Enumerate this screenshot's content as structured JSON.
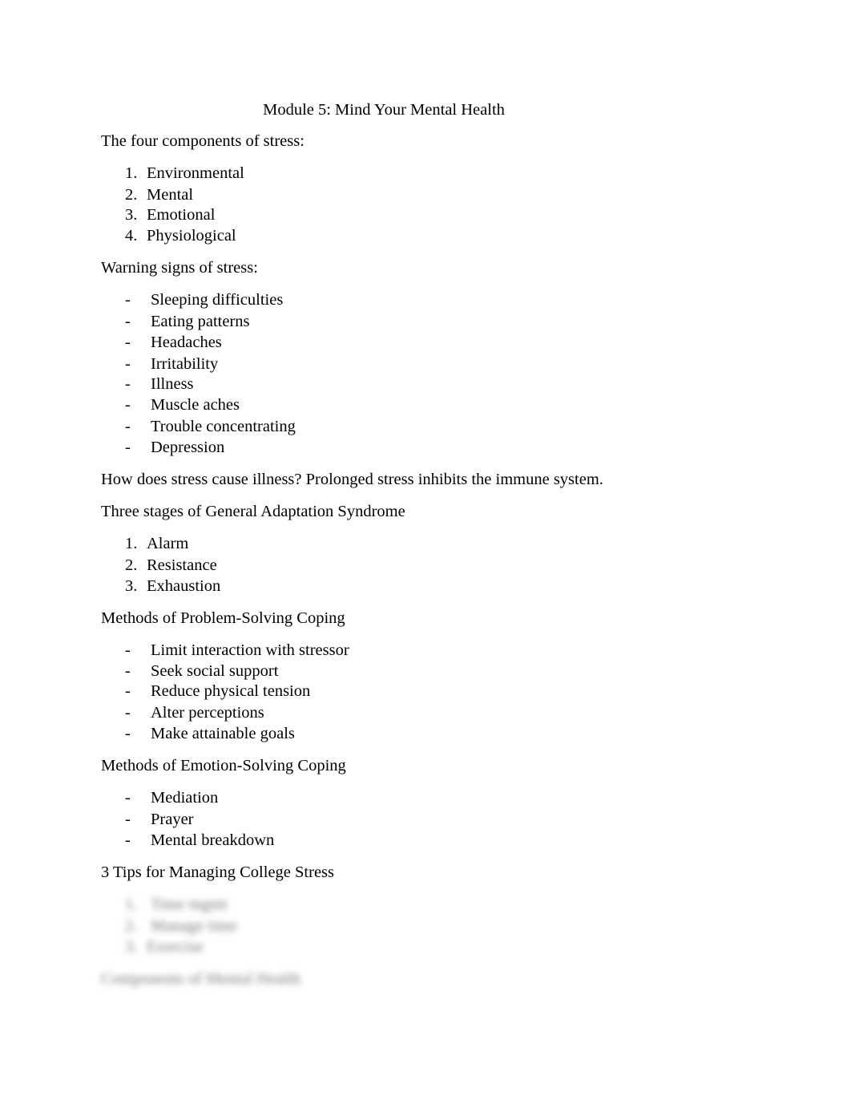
{
  "document": {
    "title": "Module 5: Mind Your Mental Health",
    "sections": {
      "components": {
        "heading": "The four components of stress:",
        "items": [
          {
            "marker": "1.",
            "text": "Environmental"
          },
          {
            "marker": "2.",
            "text": "Mental"
          },
          {
            "marker": "3.",
            "text": "Emotional"
          },
          {
            "marker": "4.",
            "text": "Physiological"
          }
        ]
      },
      "warning_signs": {
        "heading": "Warning signs of stress:",
        "items": [
          {
            "marker": "-",
            "text": "Sleeping difficulties"
          },
          {
            "marker": "-",
            "text": "Eating patterns"
          },
          {
            "marker": "-",
            "text": "Headaches"
          },
          {
            "marker": "-",
            "text": "Irritability"
          },
          {
            "marker": "-",
            "text": "Illness"
          },
          {
            "marker": "-",
            "text": "Muscle aches"
          },
          {
            "marker": "-",
            "text": "Trouble concentrating"
          },
          {
            "marker": "-",
            "text": "Depression"
          }
        ]
      },
      "illness": {
        "text": "How does stress cause illness? Prolonged stress inhibits the immune system."
      },
      "gas": {
        "heading": "Three stages of General Adaptation Syndrome",
        "items": [
          {
            "marker": "1.",
            "text": "Alarm"
          },
          {
            "marker": "2.",
            "text": "Resistance"
          },
          {
            "marker": "3.",
            "text": "Exhaustion"
          }
        ]
      },
      "problem_coping": {
        "heading": "Methods of Problem-Solving Coping",
        "items": [
          {
            "marker": "-",
            "text": "Limit interaction with stressor"
          },
          {
            "marker": "-",
            "text": "Seek social support"
          },
          {
            "marker": "-",
            "text": "Reduce physical tension"
          },
          {
            "marker": "-",
            "text": "Alter perceptions"
          },
          {
            "marker": "-",
            "text": "Make attainable goals"
          }
        ]
      },
      "emotion_coping": {
        "heading": "Methods of Emotion-Solving Coping",
        "items": [
          {
            "marker": "-",
            "text": "Mediation"
          },
          {
            "marker": "-",
            "text": "Prayer"
          },
          {
            "marker": "-",
            "text": "Mental breakdown"
          }
        ]
      },
      "tips": {
        "heading": "3 Tips for Managing College Stress",
        "items": [
          {
            "marker": "1.",
            "text": "Time mgmt"
          },
          {
            "marker": "2.",
            "text": "Manage time"
          },
          {
            "marker": "3.",
            "text": "Exercise"
          }
        ]
      },
      "mental_health": {
        "heading": "Components of Mental Health"
      }
    }
  }
}
